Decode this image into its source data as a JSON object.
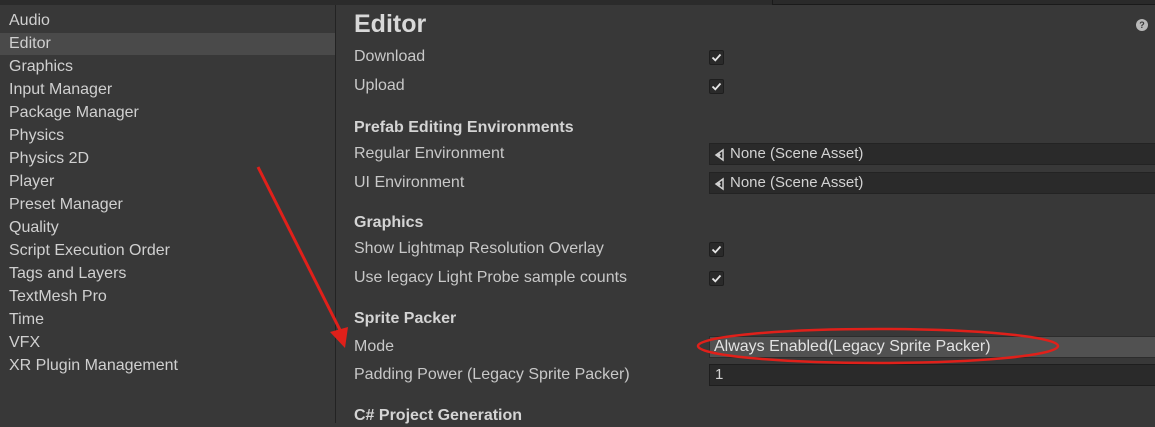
{
  "sidebar": {
    "items": [
      {
        "label": "Audio"
      },
      {
        "label": "Editor",
        "selected": true
      },
      {
        "label": "Graphics"
      },
      {
        "label": "Input Manager"
      },
      {
        "label": "Package Manager"
      },
      {
        "label": "Physics"
      },
      {
        "label": "Physics 2D"
      },
      {
        "label": "Player"
      },
      {
        "label": "Preset Manager"
      },
      {
        "label": "Quality"
      },
      {
        "label": "Script Execution Order"
      },
      {
        "label": "Tags and Layers"
      },
      {
        "label": "TextMesh Pro"
      },
      {
        "label": "Time"
      },
      {
        "label": "VFX"
      },
      {
        "label": "XR Plugin Management"
      }
    ]
  },
  "main": {
    "title": "Editor",
    "help_icon": "?",
    "download_label": "Download",
    "download_checked": true,
    "upload_label": "Upload",
    "upload_checked": true,
    "prefab_header": "Prefab Editing Environments",
    "regular_env_label": "Regular Environment",
    "regular_env_value": "None (Scene Asset)",
    "ui_env_label": "UI Environment",
    "ui_env_value": "None (Scene Asset)",
    "graphics_header": "Graphics",
    "lightmap_label": "Show Lightmap Resolution Overlay",
    "lightmap_checked": true,
    "lightprobe_label": "Use legacy Light Probe sample counts",
    "lightprobe_checked": true,
    "sprite_header": "Sprite Packer",
    "mode_label": "Mode",
    "mode_value": "Always Enabled(Legacy Sprite Packer)",
    "padding_label": "Padding Power (Legacy Sprite Packer)",
    "padding_value": "1",
    "csharp_header": "C# Project Generation"
  },
  "annotation": {
    "color": "#e0201a"
  }
}
